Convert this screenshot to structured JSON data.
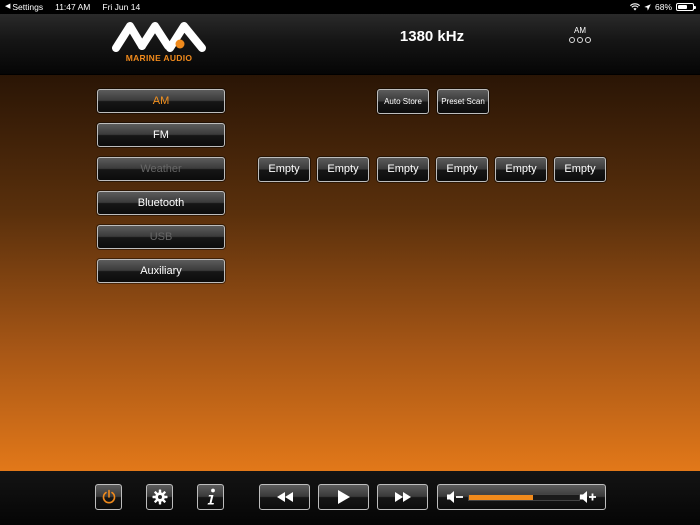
{
  "status_bar": {
    "back_label": "Settings",
    "time": "11:47 AM",
    "date": "Fri Jun 14",
    "battery_percent": "68%",
    "battery_level": 0.68
  },
  "header": {
    "logo_text": "MARINE AUDIO",
    "frequency": "1380 kHz",
    "band": "AM"
  },
  "sources": [
    {
      "label": "AM",
      "state": "selected"
    },
    {
      "label": "FM",
      "state": "normal"
    },
    {
      "label": "Weather",
      "state": "disabled"
    },
    {
      "label": "Bluetooth",
      "state": "normal"
    },
    {
      "label": "USB",
      "state": "disabled"
    },
    {
      "label": "Auxiliary",
      "state": "normal"
    }
  ],
  "tuner": {
    "auto_store_label": "Auto Store",
    "preset_scan_label": "Preset Scan",
    "presets": [
      "Empty",
      "Empty",
      "Empty",
      "Empty",
      "Empty",
      "Empty"
    ]
  },
  "footer": {
    "volume_level": 0.58
  },
  "colors": {
    "accent": "#f08a1c",
    "selected_text": "#f5921e",
    "disabled_text": "#666666"
  },
  "icons": {
    "power": "power-icon",
    "settings": "gear-icon",
    "info": "info-icon",
    "rewind": "rewind-icon",
    "play": "play-icon",
    "fast_forward": "fast-forward-icon",
    "volume_down": "volume-down-icon",
    "volume_up": "volume-up-icon"
  }
}
